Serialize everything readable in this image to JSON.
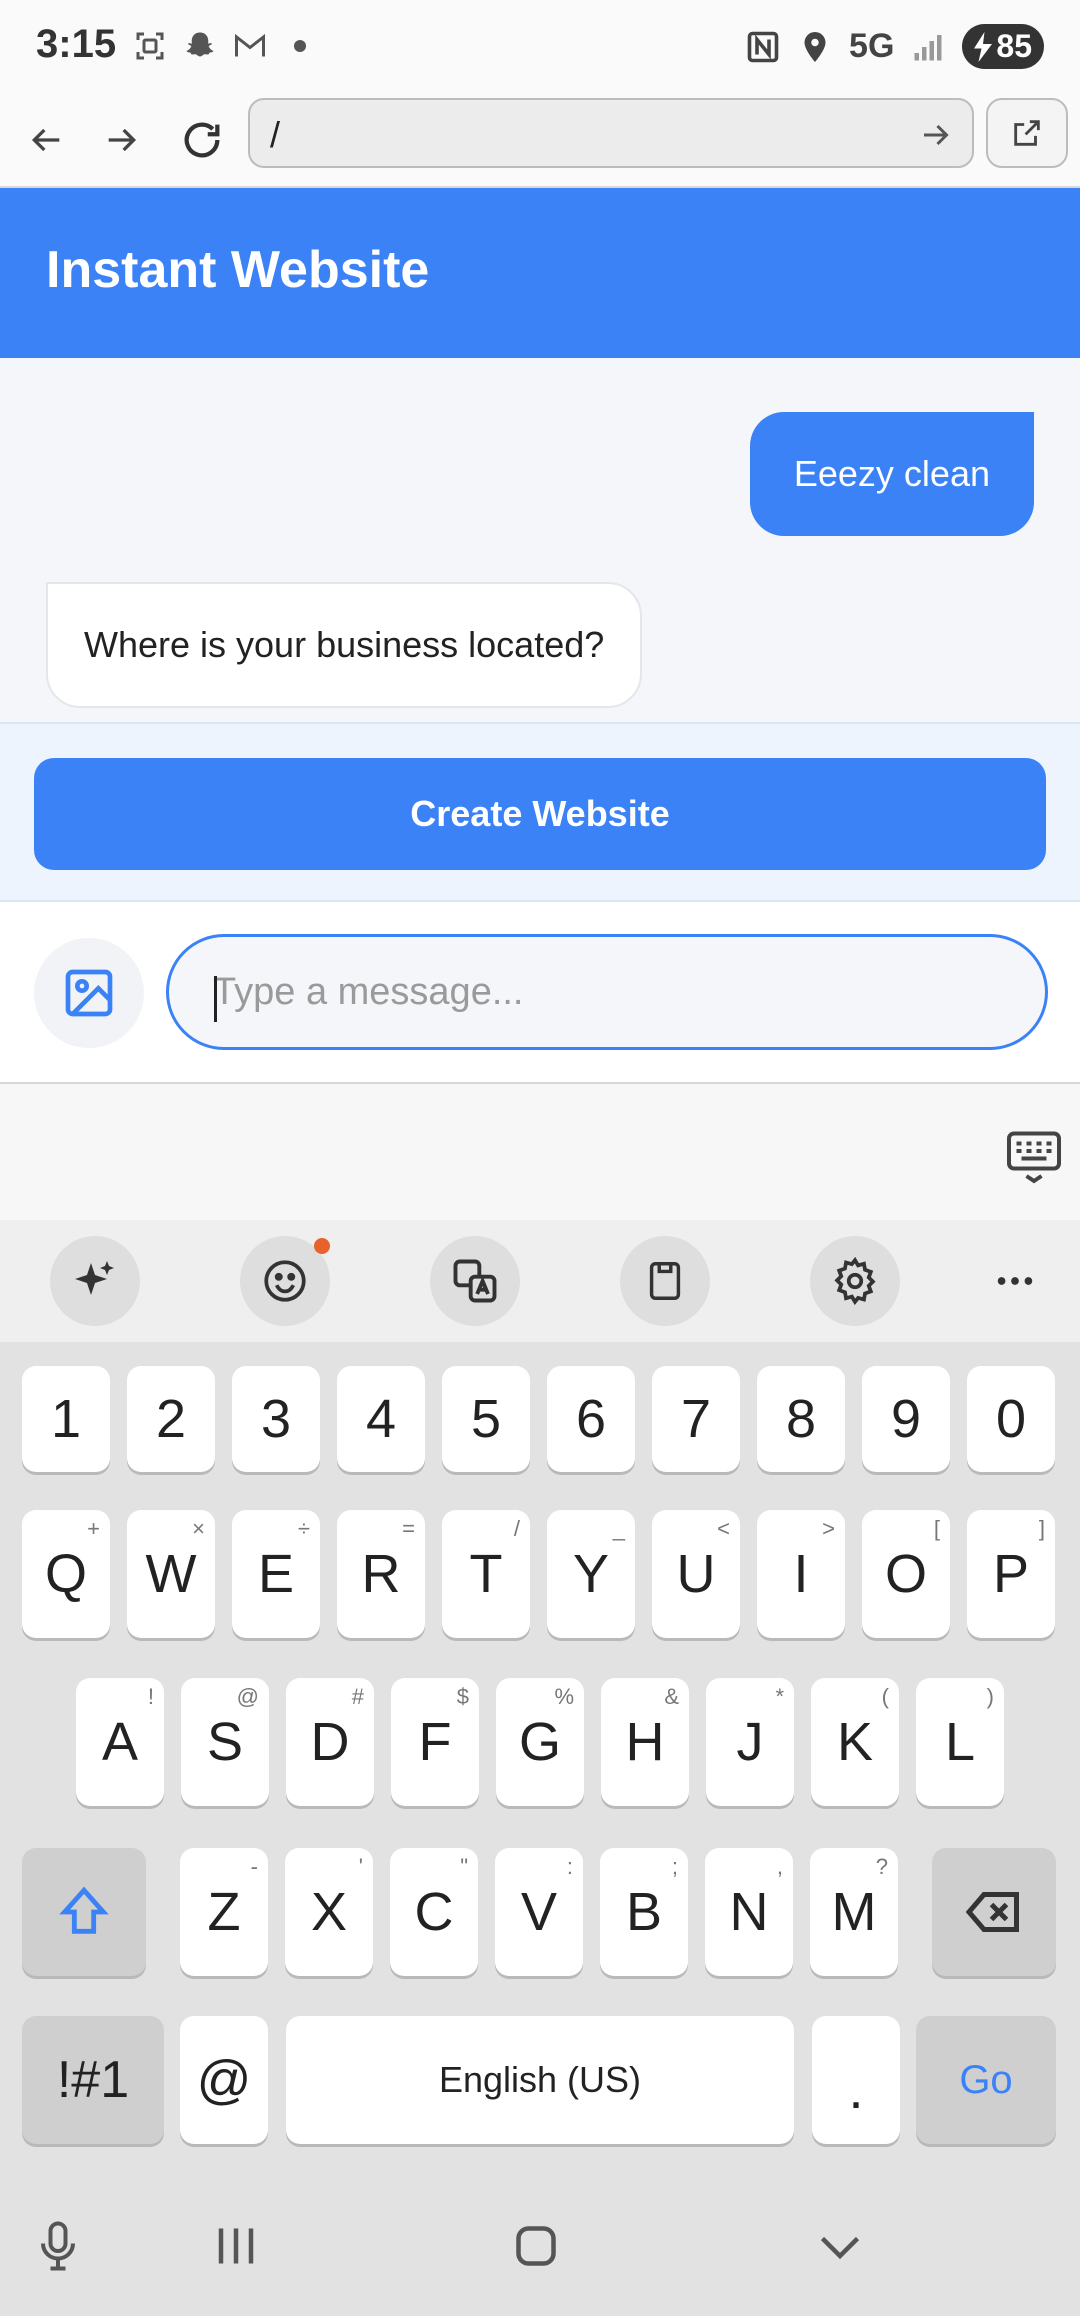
{
  "status_bar": {
    "time": "3:15",
    "network": "5G",
    "battery": "85",
    "icons_left": [
      "screenshot-icon",
      "snapchat-icon",
      "gmail-icon",
      "dot-icon"
    ],
    "icons_right": [
      "nfc-icon",
      "location-icon",
      "signal-icon",
      "battery-charging-icon"
    ]
  },
  "browser": {
    "url": "/",
    "buttons": [
      "back-arrow-icon",
      "forward-arrow-icon",
      "reload-icon",
      "open-external-icon"
    ]
  },
  "app": {
    "title": "Instant Website",
    "accent_color": "#3b82f6"
  },
  "chat": {
    "messages": [
      {
        "role": "user",
        "text": "Eeezy clean"
      },
      {
        "role": "bot",
        "text": "Where is your business located?"
      }
    ]
  },
  "create_button": {
    "label": "Create Website"
  },
  "composer": {
    "placeholder": "Type a message...",
    "value": ""
  },
  "keyboard": {
    "toolbar": [
      "sparkle-ai-icon",
      "emoji-icon",
      "translate-icon",
      "clipboard-icon",
      "settings-gear-icon",
      "more-icon"
    ],
    "row_numbers": [
      "1",
      "2",
      "3",
      "4",
      "5",
      "6",
      "7",
      "8",
      "9",
      "0"
    ],
    "row1": [
      {
        "k": "Q",
        "s": "+"
      },
      {
        "k": "W",
        "s": "×"
      },
      {
        "k": "E",
        "s": "÷"
      },
      {
        "k": "R",
        "s": "="
      },
      {
        "k": "T",
        "s": "/"
      },
      {
        "k": "Y",
        "s": "_"
      },
      {
        "k": "U",
        "s": "<"
      },
      {
        "k": "I",
        "s": ">"
      },
      {
        "k": "O",
        "s": "["
      },
      {
        "k": "P",
        "s": "]"
      }
    ],
    "row2": [
      {
        "k": "A",
        "s": "!"
      },
      {
        "k": "S",
        "s": "@"
      },
      {
        "k": "D",
        "s": "#"
      },
      {
        "k": "F",
        "s": "$"
      },
      {
        "k": "G",
        "s": "%"
      },
      {
        "k": "H",
        "s": "&"
      },
      {
        "k": "J",
        "s": "*"
      },
      {
        "k": "K",
        "s": "("
      },
      {
        "k": "L",
        "s": ")"
      }
    ],
    "row3": [
      {
        "k": "Z",
        "s": "-"
      },
      {
        "k": "X",
        "s": "'"
      },
      {
        "k": "C",
        "s": "\""
      },
      {
        "k": "V",
        "s": ":"
      },
      {
        "k": "B",
        "s": ";"
      },
      {
        "k": "N",
        "s": ","
      },
      {
        "k": "M",
        "s": "?"
      }
    ],
    "symbols_key": "!#1",
    "at_key": "@",
    "space_label": "English (US)",
    "period_key": ".",
    "go_key": "Go"
  },
  "navbar": [
    "microphone-icon",
    "recent-apps-icon",
    "home-icon",
    "hide-keyboard-icon"
  ]
}
